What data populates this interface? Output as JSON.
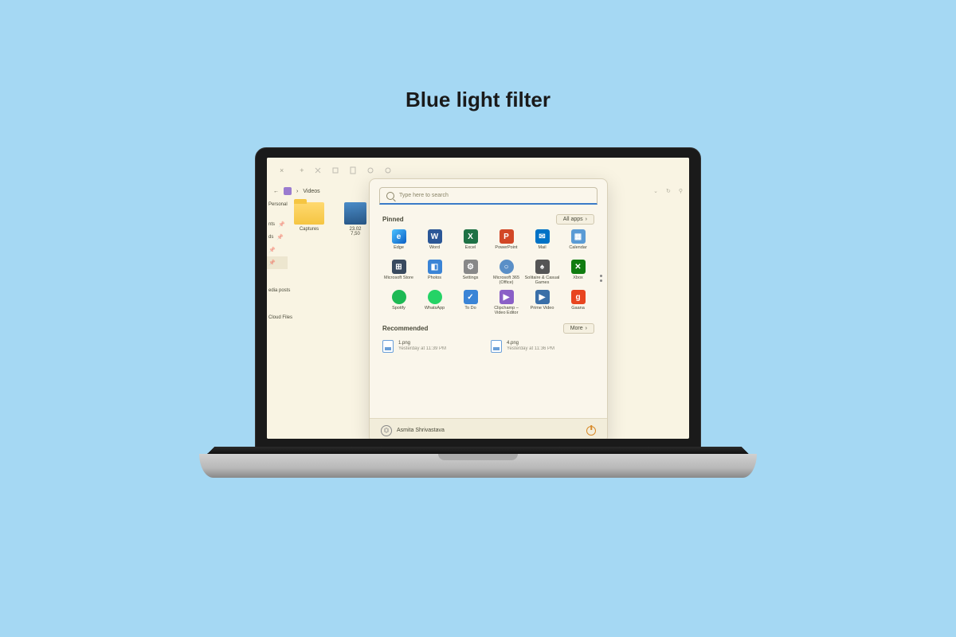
{
  "page": {
    "title": "Blue light filter"
  },
  "explorer": {
    "breadcrumb": "Videos",
    "sidebar": {
      "items": [
        {
          "label": "Personal"
        },
        {
          "label": "nts"
        },
        {
          "label": "ds"
        },
        {
          "label": ""
        },
        {
          "label": "edia posts"
        },
        {
          "label": "Cloud Files"
        }
      ]
    },
    "files": [
      {
        "kind": "folder",
        "name": "Captures"
      },
      {
        "kind": "video",
        "name": "23.02",
        "meta": "7,50"
      }
    ]
  },
  "start": {
    "search_placeholder": "Type here to search",
    "pinned_header": "Pinned",
    "all_apps_label": "All apps",
    "apps": [
      {
        "name": "Edge",
        "color": "c-edge",
        "glyph": "e"
      },
      {
        "name": "Word",
        "color": "c-word",
        "glyph": "W"
      },
      {
        "name": "Excel",
        "color": "c-excel",
        "glyph": "X"
      },
      {
        "name": "PowerPoint",
        "color": "c-ppt",
        "glyph": "P"
      },
      {
        "name": "Mail",
        "color": "c-mail",
        "glyph": "✉"
      },
      {
        "name": "Calendar",
        "color": "c-cal",
        "glyph": "▦"
      },
      {
        "name": "Microsoft Store",
        "color": "c-store",
        "glyph": "⊞"
      },
      {
        "name": "Photos",
        "color": "c-photos",
        "glyph": "◧"
      },
      {
        "name": "Settings",
        "color": "c-settings",
        "glyph": "⚙"
      },
      {
        "name": "Microsoft 365 (Office)",
        "color": "c-m365",
        "glyph": "○"
      },
      {
        "name": "Solitaire & Casual Games",
        "color": "c-sol",
        "glyph": "♠"
      },
      {
        "name": "Xbox",
        "color": "c-xbox",
        "glyph": "✕"
      },
      {
        "name": "Spotify",
        "color": "c-spotify",
        "glyph": ""
      },
      {
        "name": "WhatsApp",
        "color": "c-wa",
        "glyph": ""
      },
      {
        "name": "To Do",
        "color": "c-todo",
        "glyph": "✓"
      },
      {
        "name": "Clipchamp – Video Editor",
        "color": "c-clip",
        "glyph": "▶"
      },
      {
        "name": "Prime Video",
        "color": "c-prime",
        "glyph": "▶"
      },
      {
        "name": "Gaana",
        "color": "c-gaana",
        "glyph": "g"
      }
    ],
    "recommended_header": "Recommended",
    "more_label": "More",
    "recommended": [
      {
        "title": "1.png",
        "subtitle": "Yesterday at 11:39 PM"
      },
      {
        "title": "4.png",
        "subtitle": "Yesterday at 11:36 PM"
      }
    ],
    "user_name": "Asmita Shrivastava"
  }
}
